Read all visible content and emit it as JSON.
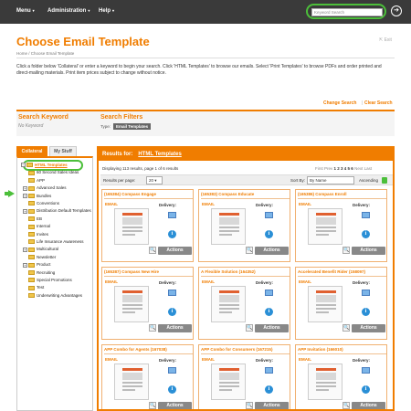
{
  "topbar": {
    "menu_label": "Menu",
    "administration_label": "Administration",
    "help_label": "Help",
    "search_placeholder": "Keyword Search"
  },
  "page": {
    "title": "Choose Email Template",
    "exit_label": "Exit",
    "breadcrumb": "Home  /  Choose Email Template",
    "intro": "Click a folder below 'Collateral' or enter a keyword to begin your search. Click 'HTML Templates' to browse our emails. Select 'Print Templates' to browse PDFs and order printed and direct-mailing materials. Print item prices subject to change without notice."
  },
  "search_links": {
    "change": "Change Search",
    "clear": "Clear Search"
  },
  "keyword_panel": {
    "keyword_heading": "Search Keyword",
    "keyword_value": "No Keyword",
    "filters_heading": "Search Filters",
    "type_label": "Type:",
    "type_value": "Email Templates"
  },
  "tabs": [
    "Collateral",
    "My Stuff"
  ],
  "tree": [
    {
      "label": "HTML Templates",
      "expander": "−",
      "selected": true
    },
    {
      "label": "60 Second Sales Ideas",
      "expander": ""
    },
    {
      "label": "APP",
      "expander": ""
    },
    {
      "label": "Advanced Sales",
      "expander": "+"
    },
    {
      "label": "Bundles",
      "expander": "+"
    },
    {
      "label": "Conventions",
      "expander": ""
    },
    {
      "label": "Distribution Default Templates",
      "expander": "+"
    },
    {
      "label": "EB",
      "expander": ""
    },
    {
      "label": "Internal",
      "expander": ""
    },
    {
      "label": "Invites",
      "expander": ""
    },
    {
      "label": "Life Insurance Awareness",
      "expander": ""
    },
    {
      "label": "Multicultural",
      "expander": "+"
    },
    {
      "label": "Newsletter",
      "expander": ""
    },
    {
      "label": "Product",
      "expander": "+"
    },
    {
      "label": "Recruiting",
      "expander": ""
    },
    {
      "label": "Special Promotions",
      "expander": ""
    },
    {
      "label": "Test",
      "expander": ""
    },
    {
      "label": "Underwriting Advantages",
      "expander": ""
    }
  ],
  "results": {
    "label": "Results for:",
    "folder": "HTML Templates",
    "info": "Displaying 113 results, page 1 of 6 results",
    "pager": {
      "first_prev": "First Prev",
      "pages": "1 2 3 4 5 6",
      "next_last": "Next Last"
    },
    "per_page_label": "Results per page:",
    "per_page_value": "20",
    "sort_label": "Sort By:",
    "sort_value": "By Name",
    "ascending_label": "Ascending"
  },
  "card_labels": {
    "type": "EMAIL",
    "delivery": "Delivery:",
    "actions": "Actions"
  },
  "cards": [
    {
      "title": "(165384) Compass Engage"
    },
    {
      "title": "(165383) Compass Educate"
    },
    {
      "title": "(165386) Compass Enroll"
    },
    {
      "title": "(165387) Compass New Hire"
    },
    {
      "title": "A Flexible Solution (164352)"
    },
    {
      "title": "Accelerated Benefit Rider (158097)"
    },
    {
      "title": "APP Combo for Agents (167038)"
    },
    {
      "title": "APP Combo for Consumers (167215)"
    },
    {
      "title": "APP Invitation (166010)"
    }
  ],
  "colors": {
    "accent": "#f07d00",
    "highlight": "#4cbf3a",
    "topbar": "#3a3a3a"
  }
}
